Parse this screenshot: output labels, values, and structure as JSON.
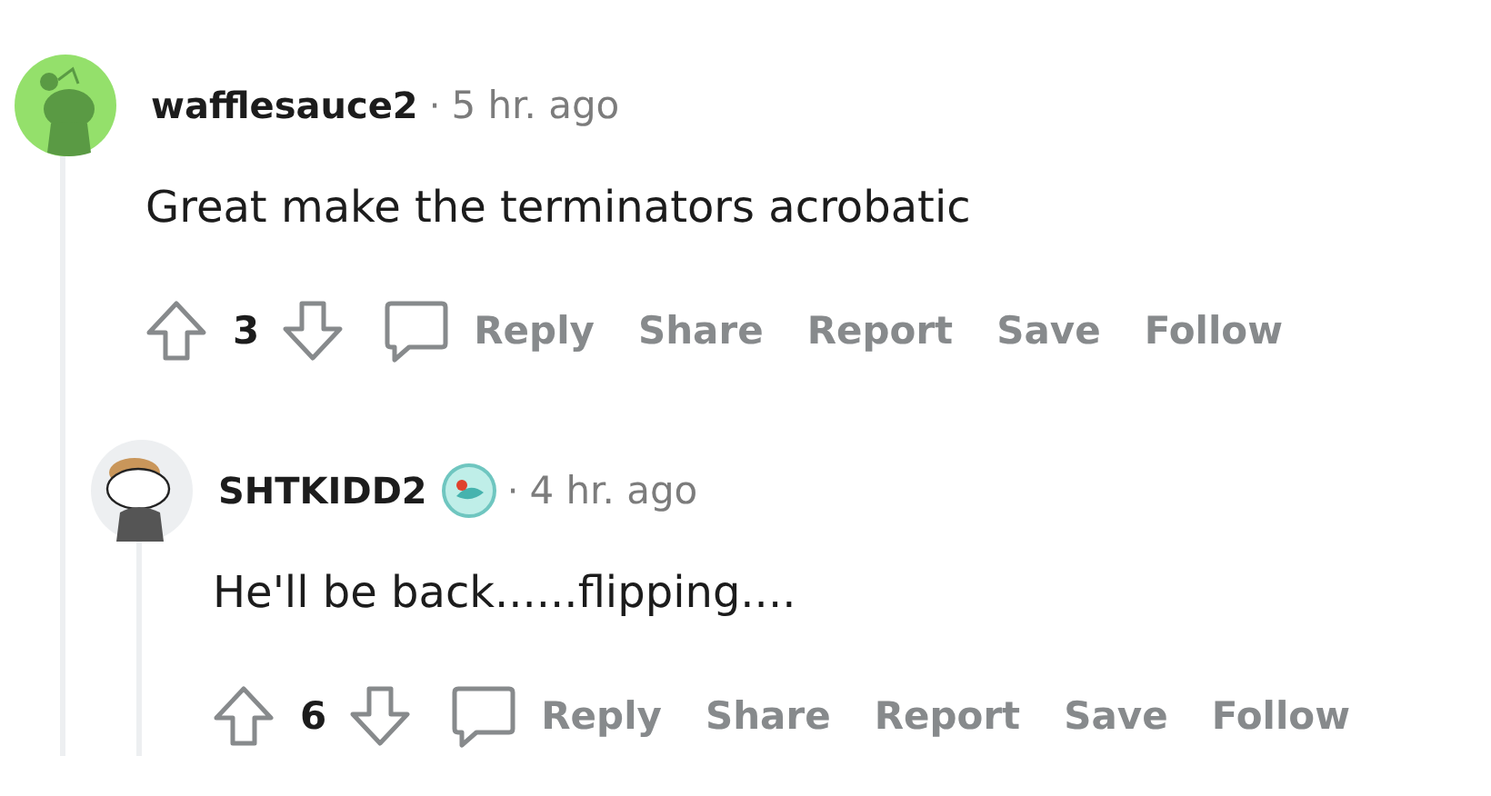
{
  "comments": [
    {
      "kind": "default",
      "user": "wafflesauce2",
      "flair": false,
      "separator": "·",
      "time": "5 hr. ago",
      "body": "Great make the terminators acrobatic",
      "votes": "3",
      "actions": [
        "Reply",
        "Share",
        "Report",
        "Save",
        "Follow"
      ],
      "children": [
        {
          "kind": "custom",
          "user": "SHTKIDD2",
          "flair": true,
          "separator": "·",
          "time": "4 hr. ago",
          "body": "He'll be back......flipping....",
          "votes": "6",
          "actions": [
            "Reply",
            "Share",
            "Report",
            "Save",
            "Follow"
          ]
        }
      ]
    }
  ]
}
